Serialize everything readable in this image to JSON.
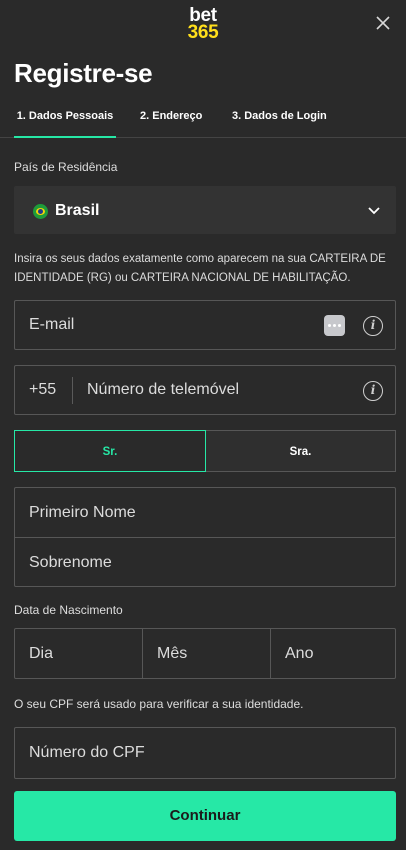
{
  "header": {
    "logo_line1": "bet",
    "logo_line2": "365",
    "close_icon": "close-icon"
  },
  "title": "Registre-se",
  "tabs": [
    {
      "label": "1. Dados Pessoais",
      "active": true
    },
    {
      "label": "2. Endereço",
      "active": false
    },
    {
      "label": "3. Dados de Login",
      "active": false
    }
  ],
  "country": {
    "label": "País de Residência",
    "value": "Brasil",
    "flag_icon": "brazil-flag-icon",
    "chevron_icon": "chevron-down-icon"
  },
  "info_text": "Insira os seus dados exatamente como aparecem na sua CARTEIRA DE IDENTIDADE (RG) ou CARTEIRA NACIONAL DE HABILITAÇÃO.",
  "email": {
    "placeholder": "E-mail",
    "value": ""
  },
  "phone": {
    "country_code": "+55",
    "placeholder": "Número de telemóvel",
    "value": ""
  },
  "gender": {
    "option_male": "Sr.",
    "option_female": "Sra.",
    "selected": "Sr."
  },
  "name": {
    "first_placeholder": "Primeiro Nome",
    "last_placeholder": "Sobrenome"
  },
  "dob": {
    "label": "Data de Nascimento",
    "day_placeholder": "Dia",
    "month_placeholder": "Mês",
    "year_placeholder": "Ano"
  },
  "cpf": {
    "info": "O seu CPF será usado para verificar a sua identidade.",
    "placeholder": "Número do CPF"
  },
  "continue_label": "Continuar",
  "colors": {
    "background": "#2a2a2a",
    "accent": "#26e8a6",
    "logo_yellow": "#ffdf1b",
    "border": "#575757"
  }
}
